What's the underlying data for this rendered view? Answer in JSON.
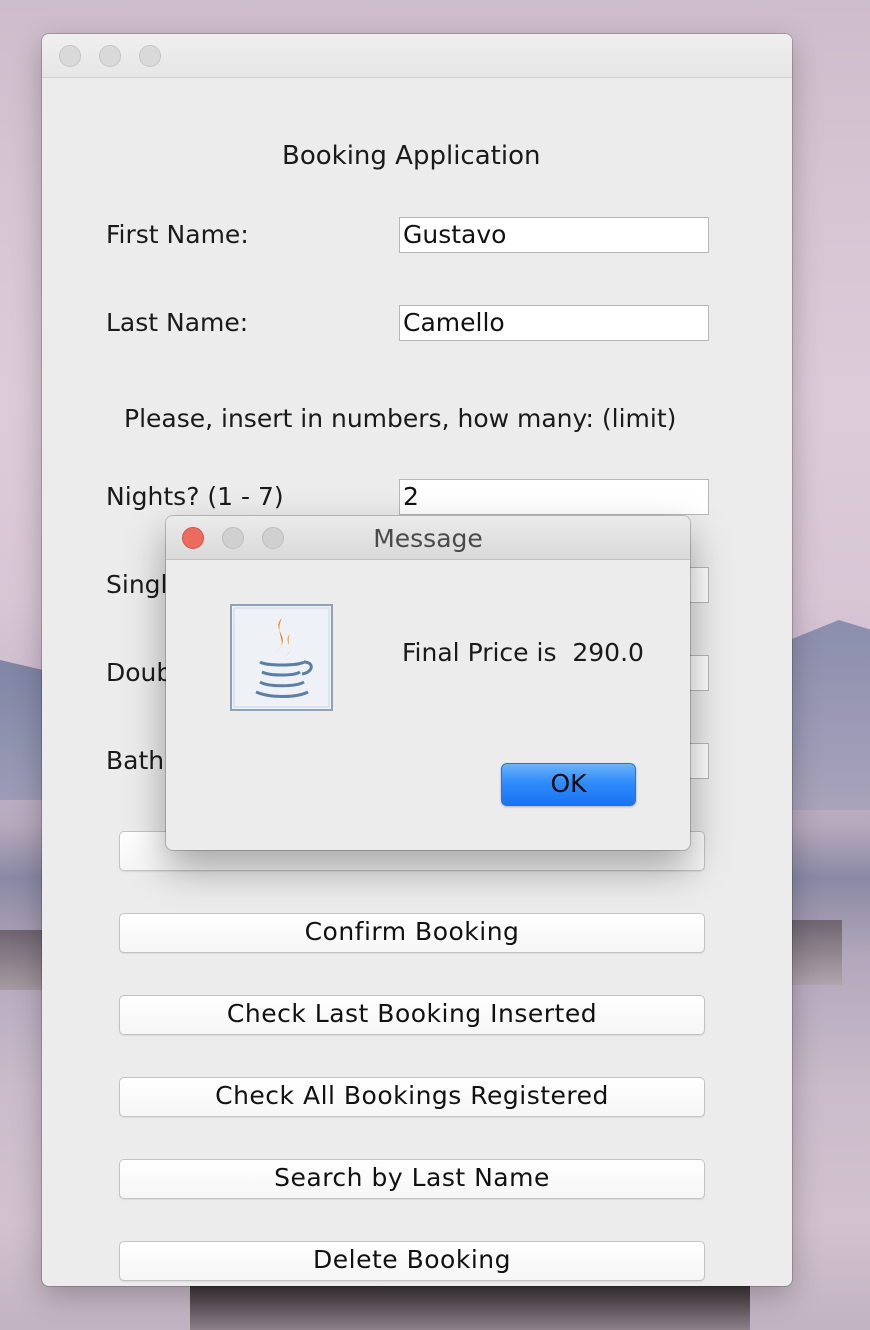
{
  "main_window": {
    "heading": "Booking Application",
    "first_name": {
      "label": "First Name:",
      "value": "Gustavo"
    },
    "last_name": {
      "label": "Last Name:",
      "value": "Camello"
    },
    "instructions": "Please, insert in numbers, how many: (limit)",
    "nights": {
      "label": "Nights? (1 - 7)",
      "value": "2"
    },
    "partial_labels": {
      "singles": "Singl",
      "doubles": "Doub",
      "bathrooms": "Bathr"
    },
    "buttons": {
      "confirm_booking": "Confirm Booking",
      "check_last_booking": "Check Last Booking Inserted",
      "check_all_bookings": "Check All Bookings Registered",
      "search_by_last_name": "Search by Last Name",
      "delete_booking": "Delete Booking"
    }
  },
  "dialog": {
    "title": "Message",
    "message": "Final Price is  290.0",
    "ok_label": "OK",
    "icon": "java-coffee-cup-icon"
  },
  "colors": {
    "window_bg": "#ececec",
    "close_red": "#ed6a5e",
    "ok_blue": "#2f8cfb"
  }
}
